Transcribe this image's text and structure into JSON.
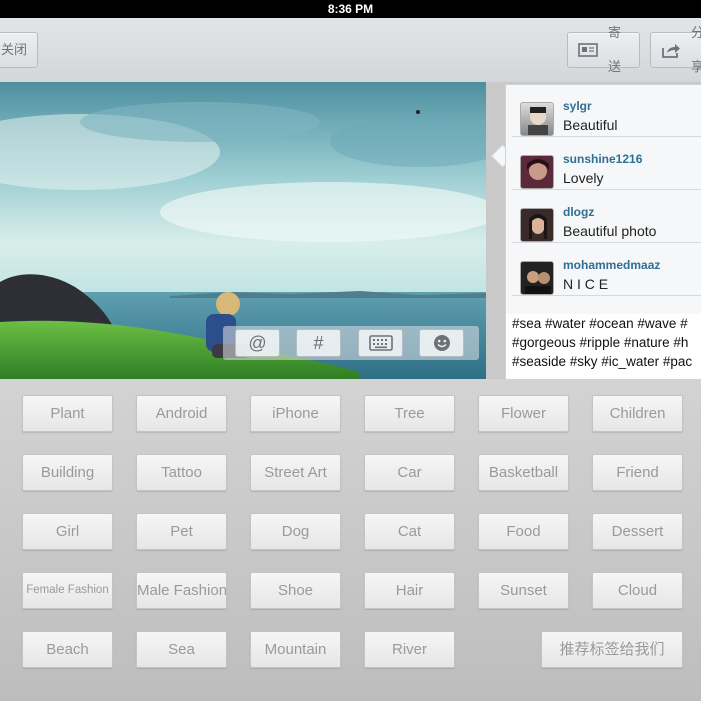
{
  "status_bar": {
    "time": "8:36 PM"
  },
  "toolbar": {
    "close_label": "关闭",
    "send_label": "寄送",
    "share_label": "分享"
  },
  "accessory": {
    "at": "@",
    "hash": "#"
  },
  "comments": [
    {
      "user": "sylgr",
      "text": "Beautiful"
    },
    {
      "user": "sunshine1216",
      "text": "Lovely"
    },
    {
      "user": "dlogz",
      "text": "Beautiful photo"
    },
    {
      "user": "mohammedmaaz",
      "text": "N I C E"
    }
  ],
  "hashtags": [
    "#sea #water #ocean #wave #",
    "#gorgeous #ripple #nature #h",
    "#seaside #sky #ic_water #pac"
  ],
  "tags": [
    [
      "Plant",
      "Android",
      "iPhone",
      "Tree",
      "Flower",
      "Children"
    ],
    [
      "Building",
      "Tattoo",
      "Street Art",
      "Car",
      "Basketball",
      "Friend"
    ],
    [
      "Girl",
      "Pet",
      "Dog",
      "Cat",
      "Food",
      "Dessert"
    ],
    [
      "Female Fashion",
      "Male Fashion",
      "Shoe",
      "Hair",
      "Sunset",
      "Cloud"
    ],
    [
      "Beach",
      "Sea",
      "Mountain",
      "River"
    ]
  ],
  "recommend_label": "推荐标签给我们",
  "colors": {
    "username": "#2f6f93",
    "tag_text": "#9a9a9a"
  }
}
